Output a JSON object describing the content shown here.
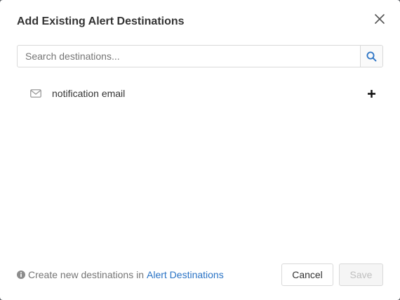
{
  "dialog": {
    "title": "Add Existing Alert Destinations",
    "close_icon": "close-icon"
  },
  "search": {
    "placeholder": "Search destinations...",
    "value": "",
    "icon": "search-icon"
  },
  "destinations": [
    {
      "name": "notification email",
      "icon": "mail-icon",
      "action_icon": "plus-icon"
    }
  ],
  "footer": {
    "note_prefix": "Create new destinations in",
    "link_text": "Alert Destinations",
    "cancel_label": "Cancel",
    "save_label": "Save"
  },
  "colors": {
    "link": "#2a73c5",
    "search_icon": "#2a73c5",
    "disabled_text": "#bfbfbf"
  }
}
